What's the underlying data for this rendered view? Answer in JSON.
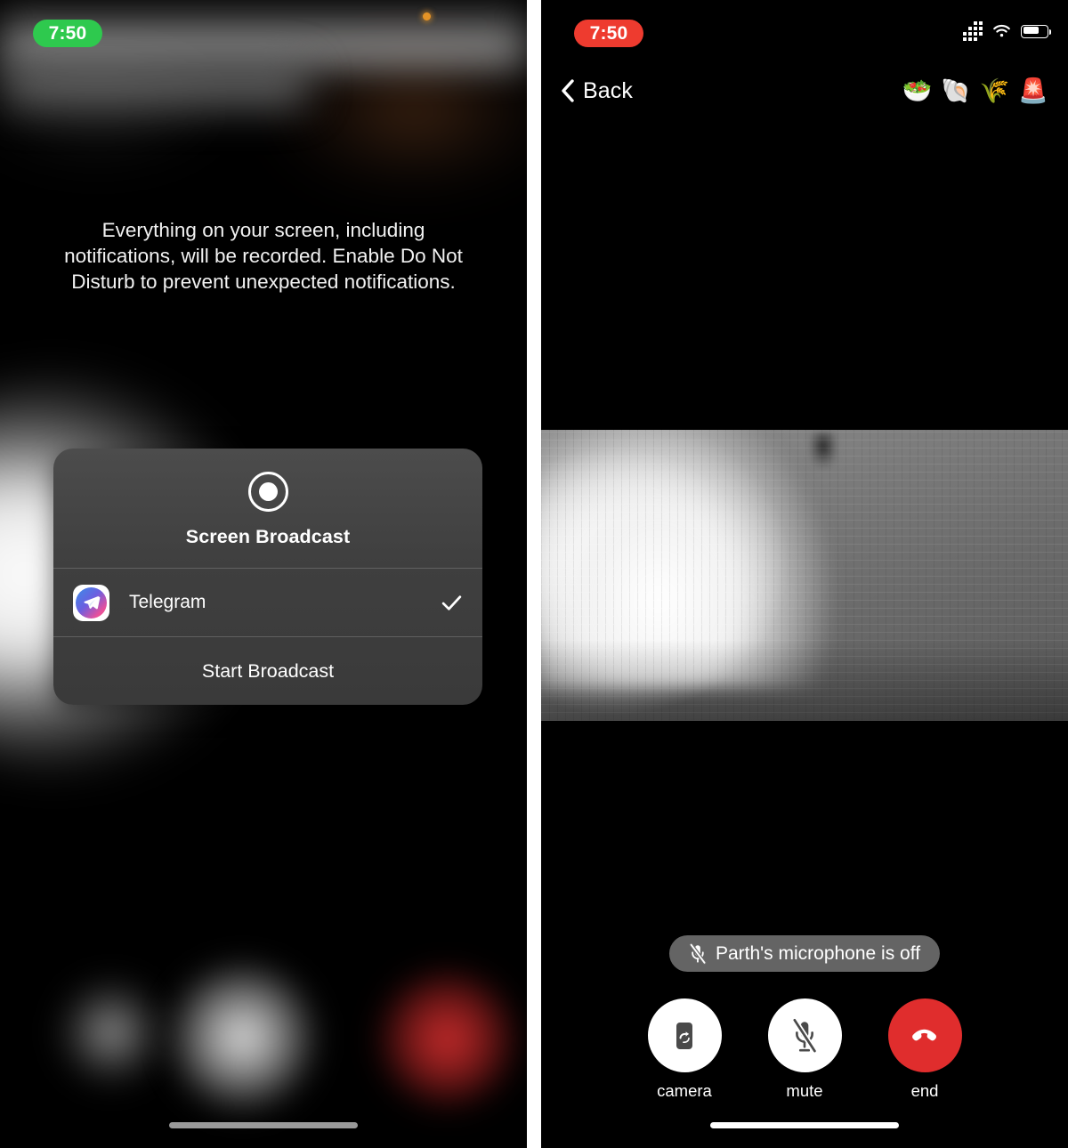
{
  "left_phone": {
    "status_bar": {
      "time": "7:50",
      "time_pill_color": "#2ec94e",
      "recording_indicator": "recording-dot-icon"
    },
    "notice_text": "Everything on your screen, including notifications, will be recorded. Enable Do Not Disturb to prevent unexpected notifications.",
    "broadcast_sheet": {
      "record_icon": "record-circle-icon",
      "title": "Screen Broadcast",
      "app_row": {
        "app_icon": "telegram-icon",
        "app_name": "Telegram",
        "selected_icon": "checkmark-icon",
        "selected": true
      },
      "action_label": "Start Broadcast"
    },
    "home_indicator": "home-indicator"
  },
  "right_phone": {
    "status_bar": {
      "time": "7:50",
      "time_pill_color": "#ee3b2f",
      "cellular_icon": "cellular-signal-icon",
      "wifi_icon": "wifi-icon",
      "battery_icon": "battery-icon"
    },
    "nav_bar": {
      "back_chevron": "chevron-left-icon",
      "back_label": "Back",
      "emojis": [
        "🥗",
        "🐚",
        "🌾",
        "🚨"
      ]
    },
    "video_feed": {
      "description": "grayscale-pixelated-camera-feed"
    },
    "mic_banner": {
      "icon": "microphone-off-icon",
      "text": "Parth's microphone is off"
    },
    "controls": [
      {
        "id": "camera",
        "label": "camera",
        "icon": "camera-flip-icon",
        "style": "white"
      },
      {
        "id": "mute",
        "label": "mute",
        "icon": "microphone-off-icon",
        "style": "white"
      },
      {
        "id": "end",
        "label": "end",
        "icon": "end-call-icon",
        "style": "red"
      }
    ],
    "home_indicator": "home-indicator"
  },
  "colors": {
    "accent_green": "#2ec94e",
    "accent_red": "#ee3b2f",
    "end_call_red": "#e02d2d",
    "sheet_bg": "#434343"
  }
}
